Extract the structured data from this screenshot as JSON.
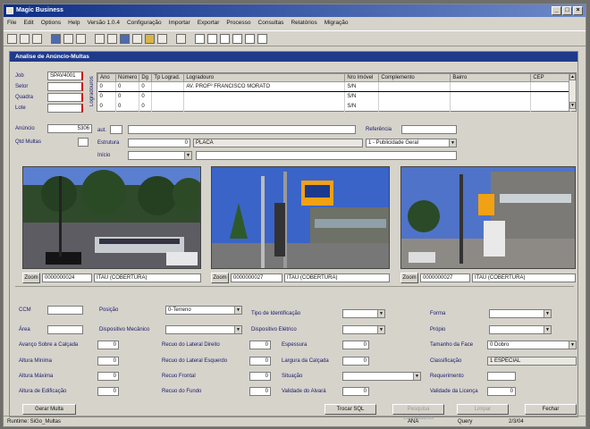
{
  "window": {
    "title": "Magic Business",
    "controls": [
      "_",
      "□",
      "×"
    ]
  },
  "menu": [
    "File",
    "Edit",
    "Options",
    "Help",
    "Versão 1.0.4",
    "Configuração",
    "Importar",
    "Exportar",
    "Processo",
    "Consultas",
    "Relatórios",
    "Migração"
  ],
  "form": {
    "title": "Analise de Anúncio-Multas",
    "left_fields": [
      {
        "label": "Job",
        "value": "SPAV4001"
      },
      {
        "label": "Setor",
        "value": ""
      },
      {
        "label": "Quadra",
        "value": ""
      },
      {
        "label": "Lote",
        "value": ""
      }
    ],
    "anuncio": {
      "label": "Anúncio",
      "value": "5306"
    },
    "qtd_multas": {
      "label": "Qtd Multas"
    },
    "vertical_label": "Logradouros",
    "grid": {
      "columns": [
        "Ano",
        "Número",
        "Dg",
        "Tp Lograd.",
        "Logradouro",
        "Nro Imóvel",
        "Complemento",
        "Bairro",
        "CEP"
      ],
      "rows": [
        [
          "0",
          "0",
          "0",
          "",
          "AV. PROFº FRANCISCO MORATO",
          "S/N",
          "",
          "",
          ""
        ],
        [
          "0",
          "0",
          "0",
          "",
          "",
          "S/N",
          "",
          "",
          ""
        ],
        [
          "0",
          "0",
          "0",
          "",
          "",
          "S/N",
          "",
          "",
          ""
        ]
      ]
    },
    "aut": {
      "label": "aut."
    },
    "estrutura": {
      "label": "Estrutura",
      "value": "PLACA"
    },
    "inicio": {
      "label": "Início"
    },
    "referencia": {
      "label": "Referência"
    },
    "publicidade": {
      "value": "1 - Publicidade Geral"
    },
    "photos": [
      {
        "zoom": "Zoom",
        "code": "0000000024",
        "desc": "ITAU (COBERTURA)"
      },
      {
        "zoom": "Zoom",
        "code": "0000000027",
        "desc": "ITAU (COBERTURA)"
      },
      {
        "zoom": "Zoom",
        "code": "0000000027",
        "desc": "ITAU (COBERTURA)"
      }
    ],
    "col1": [
      {
        "label": "CCM",
        "value": ""
      },
      {
        "label": "Área",
        "value": ""
      },
      {
        "label": "Avanço Sobre a Calçada",
        "value": "0"
      },
      {
        "label": "Altura Mínima",
        "value": "0"
      },
      {
        "label": "Altura Máxima",
        "value": "0"
      },
      {
        "label": "Altura de Edificação",
        "value": "0"
      }
    ],
    "col2": [
      {
        "label": "Posição",
        "value": "0-Terreno"
      },
      {
        "label": "Dispositivo Mecânico",
        "value": ""
      },
      {
        "label": "Recuo do Lateral Direito",
        "value": "0"
      },
      {
        "label": "Recuo do Lateral Esquerdo",
        "value": "0"
      },
      {
        "label": "Recuo Frontal",
        "value": "0"
      },
      {
        "label": "Recuo do Fundo",
        "value": "0"
      }
    ],
    "col3": [
      {
        "label": "Tipo de Identificação",
        "value": ""
      },
      {
        "label": "Dispositivo Elétrico",
        "value": ""
      },
      {
        "label": "Espessura",
        "value": "0"
      },
      {
        "label": "Largura da Calçada",
        "value": "0"
      },
      {
        "label": "Situação",
        "value": ""
      },
      {
        "label": "Validade do Alvará",
        "value": "0"
      }
    ],
    "col4": [
      {
        "label": "Forma",
        "value": ""
      },
      {
        "label": "Própio",
        "value": ""
      },
      {
        "label": "Tamanho da Face",
        "value": "0 Dobro"
      },
      {
        "label": "Classificação",
        "value": "1 ESPECIAL"
      },
      {
        "label": "Requerimento",
        "value": ""
      },
      {
        "label": "Validade da Licença",
        "value": "0"
      }
    ]
  },
  "buttons": {
    "gerar": "Gerar Multa",
    "trocar": "Trocar SQL",
    "pesquisa": "Pesquisa Logradouros",
    "limpar": "Limpar",
    "fechar": "Fechar"
  },
  "status": {
    "left": "Runtime: SiGo_Multas",
    "s1": "ANA",
    "s2": "Query",
    "s3": "2/3/04"
  }
}
